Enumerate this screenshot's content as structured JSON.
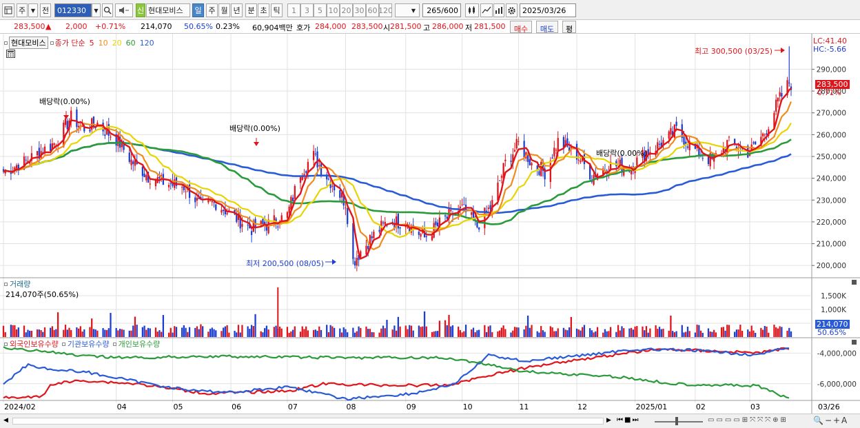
{
  "toolbar": {
    "market_short": "주",
    "prev_label": "전",
    "code_value": "012330",
    "stock_name": "현대모비스",
    "new_badge": "신",
    "periods": [
      "일",
      "주",
      "월",
      "년",
      "분",
      "초",
      "틱"
    ],
    "selected_period": "일",
    "intervals": [
      "1",
      "3",
      "5",
      "10",
      "20",
      "30",
      "60",
      "120"
    ],
    "count_value": "265",
    "count_total": "/600",
    "date_value": "2025/03/26"
  },
  "quote": {
    "price": "283,500",
    "arrow": "▲",
    "change": "2,000",
    "change_pct": "+0.71%",
    "volume": "214,070",
    "volume_ratio": "50.65%",
    "turnover": "0.23%",
    "amount": "60,904백만",
    "quote_label": "호가",
    "ask": "284,000",
    "bid": "283,500",
    "open_label": "시",
    "open": "281,500",
    "high_label": "고",
    "high": "286,000",
    "low_label": "저",
    "low": "281,500",
    "buy_label": "매수",
    "sell_label": "매도",
    "even_label": "평"
  },
  "legend": {
    "stock": "현대모비스",
    "ma_label": "종가 단순",
    "periods": [
      {
        "text": "5",
        "color": "#e0151b"
      },
      {
        "text": "10",
        "color": "#f08c1e"
      },
      {
        "text": "20",
        "color": "#e8d400"
      },
      {
        "text": "60",
        "color": "#2a9a3a"
      },
      {
        "text": "120",
        "color": "#2a5bd7"
      }
    ]
  },
  "annotations": {
    "high": "최고 300,500 (03/25)",
    "low": "최저 200,500 (08/05)",
    "dividend_1": "배당락(0.00%)",
    "dividend_2": "배당락(0.00%)",
    "dividend_3": "배당락(0.00%)"
  },
  "right_info": {
    "lc": "LC:41.40",
    "hc": "HC:-5.66",
    "price_tag": "283,500",
    "pct_tag": "0.71%"
  },
  "volume_panel": {
    "title": "거래량",
    "value_text": "214,070주(50.65%)",
    "tag_value": "214,070",
    "tag_pct": "50.65%"
  },
  "holdings_panel": {
    "series": [
      "외국인보유수량",
      "기관보유수량",
      "개인보유수량"
    ]
  },
  "x_axis": {
    "labels": [
      "2024/02",
      "04",
      "05",
      "06",
      "07",
      "08",
      "09",
      "10",
      "11",
      "12",
      "2025/01",
      "02",
      "03"
    ],
    "right_label": "03/26"
  },
  "chart_data": [
    {
      "type": "candlestick",
      "title": "현대모비스",
      "x_range": [
        "2024/02",
        "2025/03/26"
      ],
      "ylim": [
        195000,
        305000
      ],
      "y_ticks": [
        290000,
        280000,
        270000,
        260000,
        250000,
        240000,
        230000,
        220000,
        210000,
        200000
      ],
      "y_tick_labels": [
        "290,000",
        "280,000",
        "270,000",
        "260,000",
        "250,000",
        "240,000",
        "230,000",
        "220,000",
        "210,000",
        "200,000"
      ],
      "close_series": [
        [
          "2024-02-01",
          243000
        ],
        [
          "2024-02-13",
          248000
        ],
        [
          "2024-02-28",
          256000
        ],
        [
          "2024-03-08",
          268000
        ],
        [
          "2024-03-14",
          263000
        ],
        [
          "2024-03-22",
          265000
        ],
        [
          "2024-04-02",
          257000
        ],
        [
          "2024-04-09",
          248000
        ],
        [
          "2024-04-18",
          241000
        ],
        [
          "2024-04-26",
          238000
        ],
        [
          "2024-05-08",
          236000
        ],
        [
          "2024-05-16",
          227000
        ],
        [
          "2024-05-24",
          229000
        ],
        [
          "2024-06-03",
          222000
        ],
        [
          "2024-06-12",
          217000
        ],
        [
          "2024-06-21",
          219000
        ],
        [
          "2024-07-01",
          223000
        ],
        [
          "2024-07-08",
          243000
        ],
        [
          "2024-07-15",
          250000
        ],
        [
          "2024-07-22",
          241000
        ],
        [
          "2024-08-01",
          229000
        ],
        [
          "2024-08-05",
          202000
        ],
        [
          "2024-08-14",
          212000
        ],
        [
          "2024-08-23",
          220000
        ],
        [
          "2024-09-02",
          220000
        ],
        [
          "2024-09-12",
          213000
        ],
        [
          "2024-09-24",
          222000
        ],
        [
          "2024-10-02",
          226000
        ],
        [
          "2024-10-10",
          218000
        ],
        [
          "2024-10-18",
          228000
        ],
        [
          "2024-10-25",
          247000
        ],
        [
          "2024-11-01",
          256000
        ],
        [
          "2024-11-08",
          247000
        ],
        [
          "2024-11-15",
          243000
        ],
        [
          "2024-11-22",
          257000
        ],
        [
          "2024-12-02",
          251000
        ],
        [
          "2024-12-10",
          241000
        ],
        [
          "2024-12-19",
          246000
        ],
        [
          "2024-12-30",
          245000
        ],
        [
          "2025-01-08",
          252000
        ],
        [
          "2025-01-16",
          256000
        ],
        [
          "2025-01-24",
          262000
        ],
        [
          "2025-02-04",
          252000
        ],
        [
          "2025-02-12",
          248000
        ],
        [
          "2025-02-20",
          256000
        ],
        [
          "2025-03-04",
          252000
        ],
        [
          "2025-03-12",
          261000
        ],
        [
          "2025-03-19",
          275000
        ],
        [
          "2025-03-25",
          284000
        ],
        [
          "2025-03-26",
          283500
        ]
      ],
      "high": {
        "value": 300500,
        "date": "03/25"
      },
      "low": {
        "value": 200500,
        "date": "08/05"
      },
      "moving_averages": [
        "5",
        "10",
        "20",
        "60",
        "120"
      ]
    },
    {
      "type": "bar",
      "title": "거래량",
      "y_ticks": [
        1500000,
        1000000,
        500000
      ],
      "y_tick_labels": [
        "1,500K",
        "1,000K",
        "500K"
      ],
      "last_value": 214070
    },
    {
      "type": "line",
      "title": "외국인보유수량 / 기관보유수량 / 개인보유수량",
      "y_ticks": [
        -4000000,
        -6000000
      ],
      "y_tick_labels": [
        "-4,000,000",
        "-6,000,000"
      ],
      "series": [
        {
          "name": "외국인보유수량",
          "color": "#e0151b"
        },
        {
          "name": "기관보유수량",
          "color": "#2a5bd7"
        },
        {
          "name": "개인보유수량",
          "color": "#2a9a3a"
        }
      ]
    }
  ]
}
